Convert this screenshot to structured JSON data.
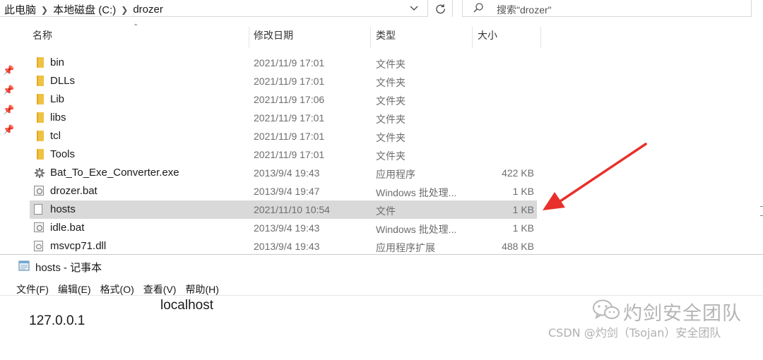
{
  "address": {
    "crumbs": [
      "此电脑",
      "本地磁盘 (C:)",
      "drozer"
    ]
  },
  "search": {
    "placeholder": "搜索\"drozer\""
  },
  "columns": {
    "name": "名称",
    "date": "修改日期",
    "type": "类型",
    "size": "大小"
  },
  "files": [
    {
      "name": "bin",
      "date": "2021/11/9 17:01",
      "type": "文件夹",
      "size": "",
      "icon": "folder-icon"
    },
    {
      "name": "DLLs",
      "date": "2021/11/9 17:01",
      "type": "文件夹",
      "size": "",
      "icon": "folder-icon"
    },
    {
      "name": "Lib",
      "date": "2021/11/9 17:06",
      "type": "文件夹",
      "size": "",
      "icon": "folder-icon"
    },
    {
      "name": "libs",
      "date": "2021/11/9 17:01",
      "type": "文件夹",
      "size": "",
      "icon": "folder-icon"
    },
    {
      "name": "tcl",
      "date": "2021/11/9 17:01",
      "type": "文件夹",
      "size": "",
      "icon": "folder-icon"
    },
    {
      "name": "Tools",
      "date": "2021/11/9 17:01",
      "type": "文件夹",
      "size": "",
      "icon": "folder-icon"
    },
    {
      "name": "Bat_To_Exe_Converter.exe",
      "date": "2013/9/4 19:43",
      "type": "应用程序",
      "size": "422 KB",
      "icon": "exe-icon"
    },
    {
      "name": "drozer.bat",
      "date": "2013/9/4 19:47",
      "type": "Windows 批处理...",
      "size": "1 KB",
      "icon": "bat-file-icon"
    },
    {
      "name": "hosts",
      "date": "2021/11/10 10:54",
      "type": "文件",
      "size": "1 KB",
      "icon": "file-icon",
      "selected": true
    },
    {
      "name": "idle.bat",
      "date": "2013/9/4 19:43",
      "type": "Windows 批处理...",
      "size": "1 KB",
      "icon": "bat-file-icon"
    },
    {
      "name": "msvcp71.dll",
      "date": "2013/9/4 19:43",
      "type": "应用程序扩展",
      "size": "488 KB",
      "icon": "dll-file-icon"
    }
  ],
  "notepad": {
    "title": "hosts - 记事本",
    "menus": [
      "文件(F)",
      "编辑(E)",
      "格式(O)",
      "查看(V)",
      "帮助(H)"
    ],
    "content_ip": "127.0.0.1",
    "content_host": "localhost"
  },
  "watermark": {
    "title": "灼剑安全团队",
    "subtitle": "CSDN @灼剑（Tsojan）安全团队"
  },
  "annotation": {
    "arrow_color": "#e8302a"
  }
}
